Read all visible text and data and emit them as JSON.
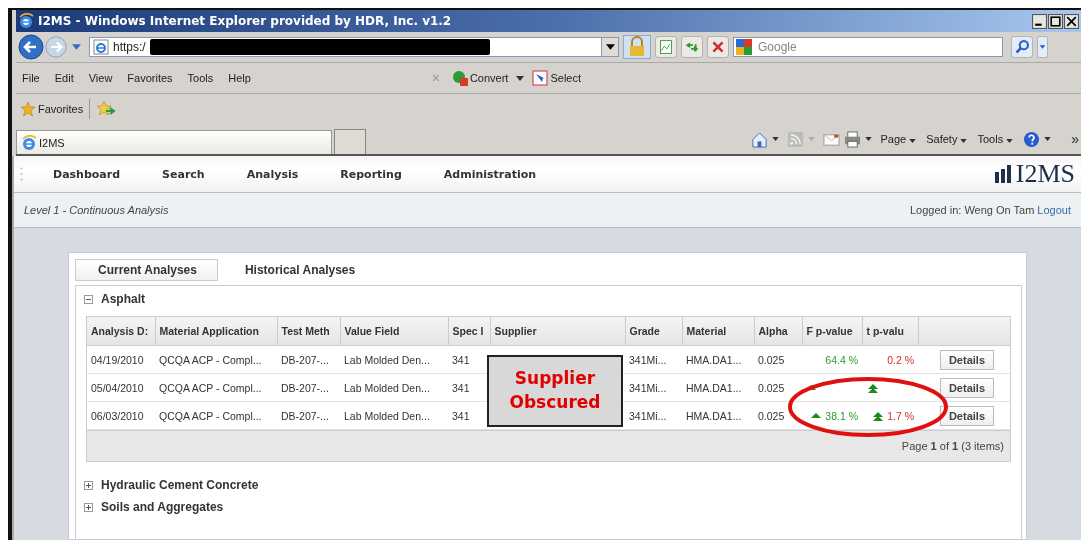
{
  "browser": {
    "title": "I2MS - Windows Internet Explorer provided by HDR, Inc. v1.2",
    "address": "https:/",
    "search": {
      "placeholder": "Google"
    },
    "menu": [
      "File",
      "Edit",
      "View",
      "Favorites",
      "Tools",
      "Help"
    ],
    "toolbar": {
      "stop": "×",
      "convert": "Convert",
      "select": "Select"
    },
    "favorites": "Favorites",
    "tab": "I2MS",
    "commands": [
      "Page",
      "Safety",
      "Tools"
    ],
    "overflow": "»"
  },
  "app": {
    "nav": [
      "Dashboard",
      "Search",
      "Analysis",
      "Reporting",
      "Administration"
    ],
    "logo": "I2MS",
    "breadcrumb": "Level 1 - Continuous Analysis",
    "user": "Logged in: Weng On Tam",
    "logout": "Logout",
    "tabs": [
      {
        "label": "Current Analyses",
        "selected": true
      },
      {
        "label": "Historical Analyses",
        "selected": false
      }
    ],
    "sections": [
      {
        "title": "Asphalt",
        "expanded": true,
        "table": {
          "columns": [
            "Analysis D:",
            "Material Application",
            "Test Meth",
            "Value Field",
            "Spec I",
            "Supplier",
            "Grade",
            "Material",
            "Alpha",
            "F p-value",
            "t p-valu"
          ],
          "rows": [
            {
              "date": "04/19/2010",
              "application": "QCQA ACP - Compl...",
              "method": "DB-207-...",
              "field": "Lab Molded Den...",
              "spec": "341",
              "grade": "341Mi...",
              "material": "HMA.DA1...",
              "alpha": "0.025",
              "f": {
                "text": "64.4 %",
                "up": false
              },
              "t": {
                "text": "0.2 %",
                "up": false
              },
              "action": "Details"
            },
            {
              "date": "05/04/2010",
              "application": "QCQA ACP - Compl...",
              "method": "DB-207-...",
              "field": "Lab Molded Den...",
              "spec": "341",
              "grade": "341Mi...",
              "material": "HMA.DA1...",
              "alpha": "0.025",
              "f": {
                "up": true
              },
              "t": {
                "up": true
              },
              "action": "Details"
            },
            {
              "date": "06/03/2010",
              "application": "QCQA ACP - Compl...",
              "method": "DB-207-...",
              "field": "Lab Molded Den...",
              "spec": "341",
              "grade": "341Mi...",
              "material": "HMA.DA1...",
              "alpha": "0.025",
              "f": {
                "text": "38.1 %",
                "up": true
              },
              "t": {
                "text": "1.7 %",
                "up": true
              },
              "action": "Details"
            }
          ],
          "pager": "Page **1** of **1** (3 items)"
        }
      },
      {
        "title": "Hydraulic Cement Concrete",
        "expanded": false
      },
      {
        "title": "Soils and Aggregates",
        "expanded": false
      }
    ]
  },
  "annotation": {
    "redaction": "Supplier Obscured"
  }
}
